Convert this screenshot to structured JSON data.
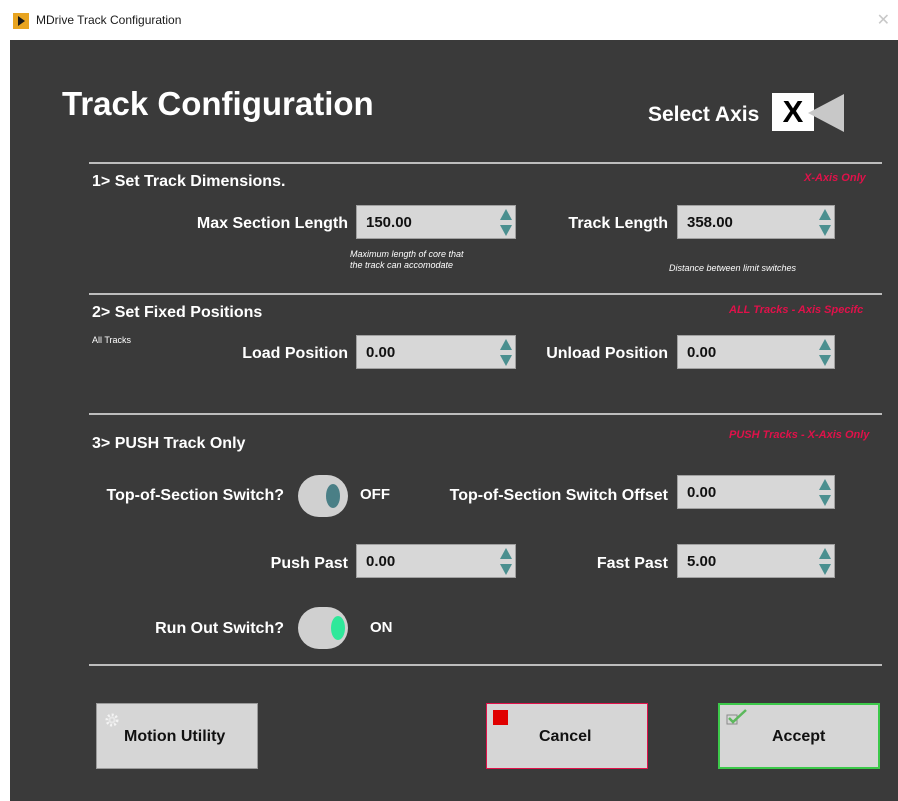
{
  "window": {
    "title": "MDrive Track Configuration",
    "close_glyph": "✕"
  },
  "header": {
    "title": "Track Configuration",
    "select_axis_label": "Select Axis",
    "axis_value": "X"
  },
  "section1": {
    "title": "1> Set Track Dimensions.",
    "scope": "X-Axis Only",
    "max_section_length": {
      "label": "Max Section Length",
      "value": "150.00",
      "hint_line1": "Maximum length of core that",
      "hint_line2": "the track can accomodate"
    },
    "track_length": {
      "label": "Track Length",
      "value": "358.00",
      "hint": "Distance between limit switches"
    }
  },
  "section2": {
    "title": "2> Set Fixed Positions",
    "scope": "ALL Tracks - Axis Specifc",
    "note": "All Tracks",
    "load_position": {
      "label": "Load Position",
      "value": "0.00"
    },
    "unload_position": {
      "label": "Unload Position",
      "value": "0.00"
    }
  },
  "section3": {
    "title": "3> PUSH Track Only",
    "scope": "PUSH Tracks - X-Axis Only",
    "top_switch": {
      "label": "Top-of-Section Switch?",
      "state": "OFF"
    },
    "top_switch_offset": {
      "label": "Top-of-Section Switch Offset",
      "value": "0.00"
    },
    "push_past": {
      "label": "Push Past",
      "value": "0.00"
    },
    "fast_past": {
      "label": "Fast Past",
      "value": "5.00"
    },
    "run_out_switch": {
      "label": "Run Out Switch?",
      "state": "ON"
    }
  },
  "buttons": {
    "motion_utility": "Motion Utility",
    "cancel": "Cancel",
    "accept": "Accept"
  },
  "colors": {
    "panel_bg": "#3a3a3a",
    "scope_text": "#e0114a",
    "toggle_on": "#2ee89a",
    "toggle_off": "#4a7f86",
    "cancel_border": "#e0114a",
    "accept_border": "#3cc94a"
  },
  "icons": {
    "app": "labview-run-icon",
    "motion_utility": "gear-icon",
    "cancel": "stop-icon",
    "accept": "checkmark-icon",
    "spinner": "up-down-arrows-icon",
    "axis_selector": "left-arrow-icon"
  }
}
